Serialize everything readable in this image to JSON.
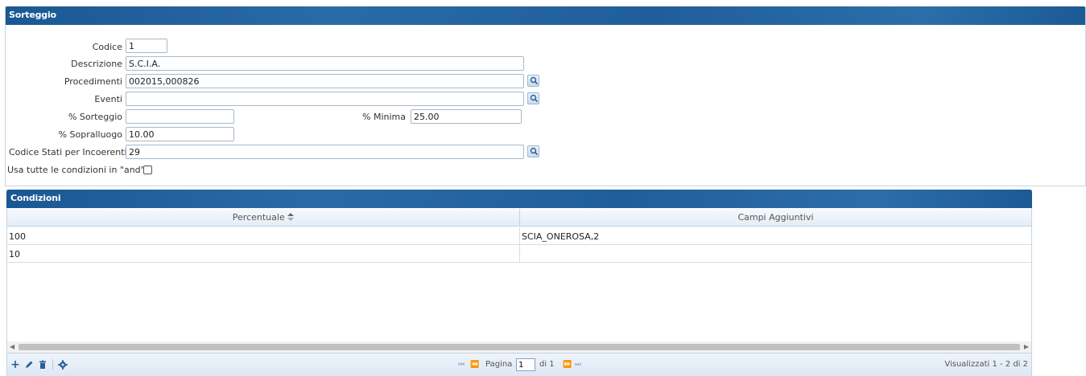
{
  "form": {
    "header": "Sorteggio",
    "fields": {
      "codice": {
        "label": "Codice",
        "value": "1"
      },
      "descrizione": {
        "label": "Descrizione",
        "value": "S.C.I.A."
      },
      "procedimenti": {
        "label": "Procedimenti",
        "value": "002015,000826"
      },
      "eventi": {
        "label": "Eventi",
        "value": ""
      },
      "sorteggio": {
        "label": "% Sorteggio",
        "value": ""
      },
      "minima": {
        "label": "% Minima",
        "value": "25.00"
      },
      "sopralluogo": {
        "label": "% Sopralluogo",
        "value": "10.00"
      },
      "stati": {
        "label": "Codice Stati per Incoerenti",
        "value": "29"
      }
    },
    "and_checkbox_label": "Usa tutte le condizioni in \"and\"",
    "and_checked": false
  },
  "grid": {
    "header": "Condizioni",
    "columns": [
      "Percentuale",
      "Campi Aggiuntivi"
    ],
    "sort_icon": "sort-asc-icon",
    "rows": [
      {
        "percentuale": "100",
        "campi": "SCIA_ONEROSA,2"
      },
      {
        "percentuale": "10",
        "campi": ""
      }
    ],
    "pager": {
      "page_label": "Pagina",
      "page_value": "1",
      "of_label": "di 1",
      "summary": "Visualizzati 1 - 2 di 2"
    },
    "toolbar_icons": [
      "add-icon",
      "edit-icon",
      "delete-icon",
      "settings-icon"
    ]
  },
  "colors": {
    "header_blue": "#1f5e9a",
    "grid_header": "#e3edf7"
  }
}
